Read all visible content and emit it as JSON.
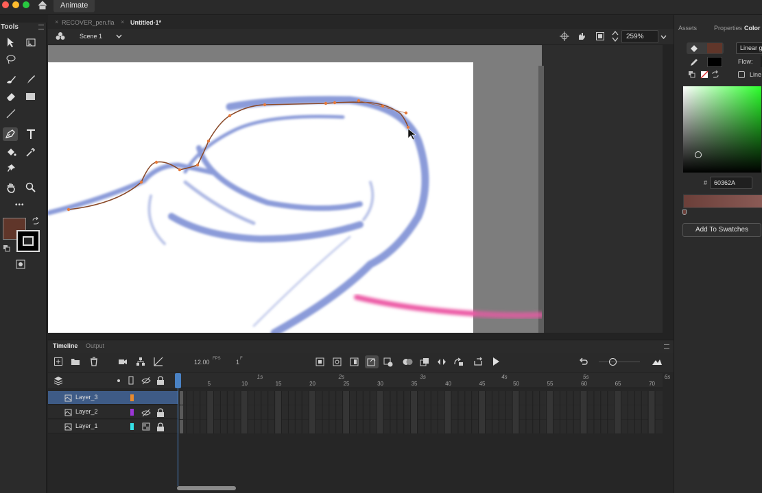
{
  "app": {
    "tab": "Animate"
  },
  "tools": {
    "header": "Tools",
    "more": "•••"
  },
  "document_tabs": [
    {
      "label": "RECOVER_pen.fla",
      "active": false
    },
    {
      "label": "Untitled-1*",
      "active": true
    }
  ],
  "editbar": {
    "scene": "Scene 1",
    "zoom": "259%"
  },
  "right_panel": {
    "tabs": [
      "Assets",
      "Properties",
      "Color"
    ],
    "fill_type": "Linear g",
    "flow_label": "Flow:",
    "linear_rgb_label": "Line",
    "hex_label": "#",
    "hex_value": "60362A",
    "add_swatch": "Add To Swatches",
    "fill_color": "#60362a",
    "stroke_color": "#000000"
  },
  "timeline": {
    "tabs": [
      "Timeline",
      "Output"
    ],
    "fps_value": "12.00",
    "fps_label": "FPS",
    "frame_value": "1",
    "frame_label": "F",
    "seconds": [
      "1s",
      "2s",
      "3s",
      "4s",
      "5s",
      "6s"
    ],
    "frame_ticks": [
      "5",
      "10",
      "15",
      "20",
      "25",
      "30",
      "35",
      "40",
      "45",
      "50",
      "55",
      "60",
      "65",
      "70"
    ],
    "layers": [
      {
        "name": "Layer_3",
        "color": "#e88a2e",
        "selected": true
      },
      {
        "name": "Layer_2",
        "color": "#9b35d6",
        "selected": false
      },
      {
        "name": "Layer_1",
        "color": "#35e0e6",
        "selected": false
      }
    ]
  },
  "colors": {
    "brush_blue": "#8b9bd9",
    "brush_pink": "#ec5aa5",
    "path_brown": "#8a4a2a",
    "anchor_orange": "#e67a3a"
  }
}
